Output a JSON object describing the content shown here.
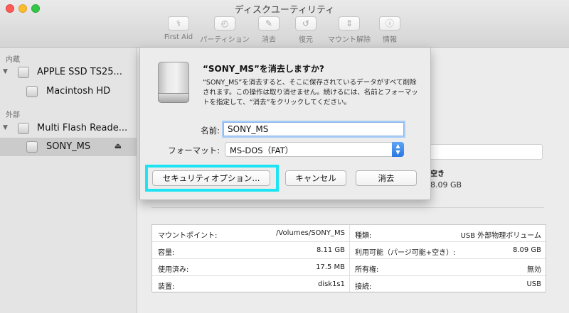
{
  "window": {
    "title": "ディスクユーティリティ"
  },
  "toolbar": {
    "first_aid": {
      "label": "First Aid",
      "icon": "stethoscope-icon"
    },
    "partition": {
      "label": "パーティション",
      "icon": "partition-icon"
    },
    "erase": {
      "label": "消去",
      "icon": "erase-icon"
    },
    "restore": {
      "label": "復元",
      "icon": "restore-icon"
    },
    "mount": {
      "label": "マウント解除",
      "icon": "unmount-icon"
    },
    "info": {
      "label": "情報",
      "icon": "info-icon"
    }
  },
  "sidebar": {
    "internal_header": "内蔵",
    "external_header": "外部",
    "items": [
      {
        "label": "APPLE SSD TS25...",
        "icon": "internal-disk-icon"
      },
      {
        "label": "Macintosh HD",
        "icon": "volume-icon"
      },
      {
        "label": "Multi Flash Reade...",
        "icon": "external-disk-icon"
      },
      {
        "label": "SONY_MS",
        "icon": "volume-icon",
        "selected": true,
        "eject": "⏏"
      }
    ]
  },
  "dialog": {
    "title": "“SONY_MS”を消去しますか?",
    "message": "“SONY_MS”を消去すると、そこに保存されているデータがすべて削除されます。この操作は取り消せません。続けるには、名前とフォーマットを指定して、“消去”をクリックしてください。",
    "name_label": "名前:",
    "name_value": "SONY_MS",
    "format_label": "フォーマット:",
    "format_value": "MS-DOS（FAT）",
    "security_button": "セキュリティオプション...",
    "cancel_button": "キャンセル",
    "erase_button": "消去"
  },
  "behind": {
    "free_label": "空き",
    "free_value": "8.09 GB"
  },
  "info_table": {
    "rows": [
      {
        "k1": "マウントポイント:",
        "v1": "/Volumes/SONY_MS",
        "k2": "種類:",
        "v2": "USB 外部物理ボリューム"
      },
      {
        "k1": "容量:",
        "v1": "8.11 GB",
        "k2": "利用可能（パージ可能+空き）:",
        "v2": "8.09 GB"
      },
      {
        "k1": "使用済み:",
        "v1": "17.5 MB",
        "k2": "所有権:",
        "v2": "無効"
      },
      {
        "k1": "装置:",
        "v1": "disk1s1",
        "k2": "接続:",
        "v2": "USB"
      }
    ]
  },
  "colors": {
    "highlight": "#1de4f2",
    "select_accent": "#2a78e4",
    "focus_ring": "#a9cdf6"
  }
}
